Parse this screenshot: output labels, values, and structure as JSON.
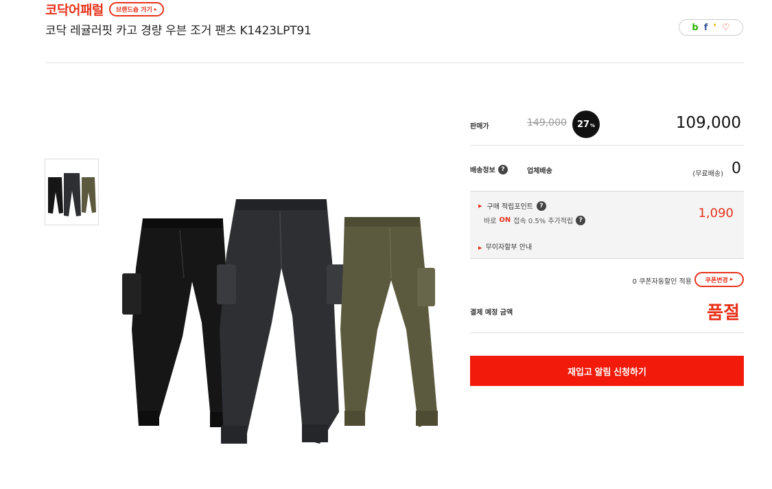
{
  "header": {
    "brand_name": "코닥어패럴",
    "brand_shop_label": "브랜드숍 가기",
    "product_title": "코닥 레귤러핏 카고 경량 우븐 조거 팬츠 K1423LPT91"
  },
  "share": {
    "icons": [
      "blog-icon",
      "facebook-icon",
      "kakao-icon",
      "heart-icon"
    ],
    "glyphs": {
      "blog": "b",
      "facebook": "f",
      "kakao": "❜",
      "heart": "♡"
    }
  },
  "gallery": {
    "colors": [
      "#161616",
      "#2e2f33",
      "#5c5a3e"
    ]
  },
  "price": {
    "label": "판매가",
    "original": "149,000",
    "discount": "27",
    "discount_unit": "%",
    "sale": "109,000"
  },
  "shipping": {
    "label": "배송정보",
    "method": "업체배송",
    "free_label": "(무료배송)",
    "cost": "0"
  },
  "points": {
    "purchase_label": "구매 적립포인트",
    "baro_prefix": "바로",
    "baro_on": "ON",
    "baro_suffix": "접속 0.5% 추가적립",
    "value": "1,090",
    "interest_free_label": "무이자할부 안내"
  },
  "coupon": {
    "text": "0 쿠폰자동할인 적용",
    "button_label": "쿠폰변경"
  },
  "payment": {
    "label": "결제 예정 금액",
    "status": "품절"
  },
  "cta": {
    "restock_label": "재입고 알림 신청하기"
  },
  "colors": {
    "accent": "#e8311a",
    "cta_bg": "#f21a0a"
  }
}
